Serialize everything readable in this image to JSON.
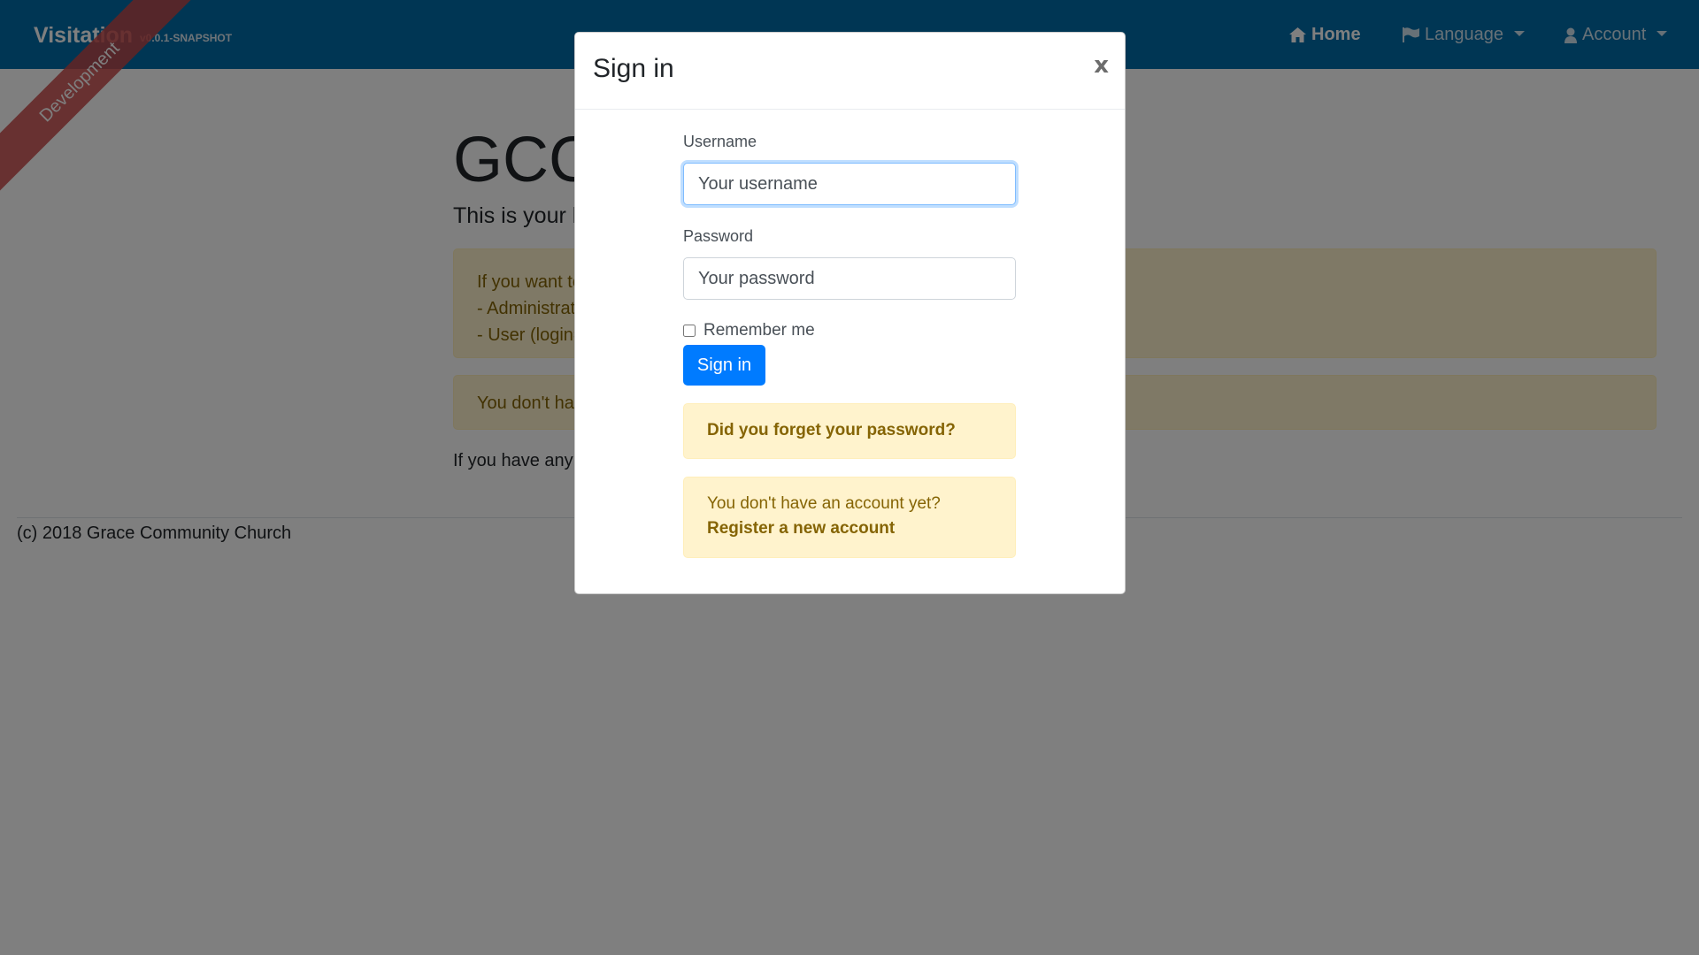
{
  "navbar": {
    "brand": "Visitation",
    "version": "v0.0.1-SNAPSHOT",
    "home_label": "Home",
    "language_label": "Language",
    "account_label": "Account",
    "icons": {
      "home": "home-icon",
      "language": "flag-icon",
      "account": "user-icon"
    }
  },
  "ribbon": {
    "label": "Development"
  },
  "page": {
    "title": "GCC",
    "lead": "This is your h",
    "demo_alert": [
      "If you want to",
      "- Administrat",
      "- User (login="
    ],
    "no_account_alert": "You don't hav",
    "contact": "If you have any q"
  },
  "footer": {
    "text": "(c) 2018 Grace Community Church"
  },
  "modal": {
    "title": "Sign in",
    "close_label": "x",
    "username_label": "Username",
    "username_placeholder": "Your username",
    "password_label": "Password",
    "password_placeholder": "Your password",
    "remember_label": "Remember me",
    "submit_label": "Sign in",
    "forgot_link": "Did you forget your password?",
    "no_account_text": "You don't have an account yet?",
    "register_link": "Register a new account"
  },
  "colors": {
    "navbar": "#016da8",
    "primary": "#007bff",
    "warning_bg": "#fff3cd",
    "warning_text": "#856404",
    "ribbon": "#c84646"
  }
}
